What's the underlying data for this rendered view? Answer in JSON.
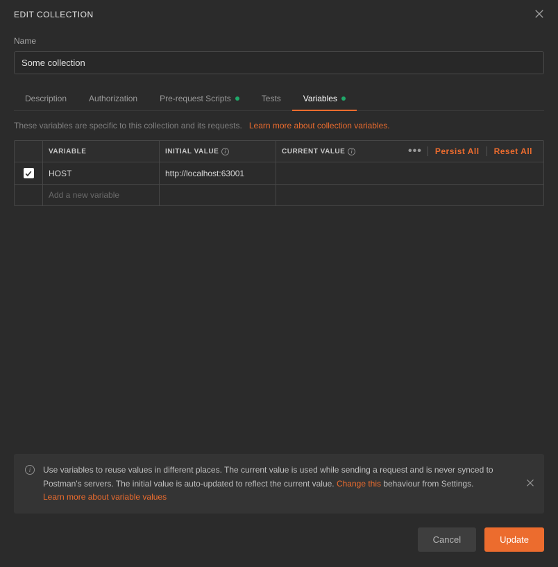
{
  "dialog": {
    "title": "EDIT COLLECTION",
    "nameLabel": "Name",
    "nameValue": "Some collection"
  },
  "tabs": [
    {
      "label": "Description",
      "indicator": false,
      "active": false
    },
    {
      "label": "Authorization",
      "indicator": false,
      "active": false
    },
    {
      "label": "Pre-request Scripts",
      "indicator": true,
      "active": false
    },
    {
      "label": "Tests",
      "indicator": false,
      "active": false
    },
    {
      "label": "Variables",
      "indicator": true,
      "active": true
    }
  ],
  "hint": {
    "text": "These variables are specific to this collection and its requests.",
    "linkText": "Learn more about collection variables."
  },
  "table": {
    "headers": {
      "variable": "VARIABLE",
      "initial": "INITIAL VALUE",
      "current": "CURRENT VALUE"
    },
    "actions": {
      "persist": "Persist All",
      "reset": "Reset All"
    },
    "rows": [
      {
        "checked": true,
        "variable": "HOST",
        "initial": "http://localhost:63001",
        "current": ""
      }
    ],
    "addPlaceholder": "Add a new variable"
  },
  "banner": {
    "text1": "Use variables to reuse values in different places. The current value is used while sending a request and is never synced to Postman's servers. The initial value is auto-updated to reflect the current value. ",
    "changeLink": "Change this",
    "text2": " behaviour from Settings.",
    "learnLink": "Learn more about variable values"
  },
  "footer": {
    "cancel": "Cancel",
    "update": "Update"
  }
}
